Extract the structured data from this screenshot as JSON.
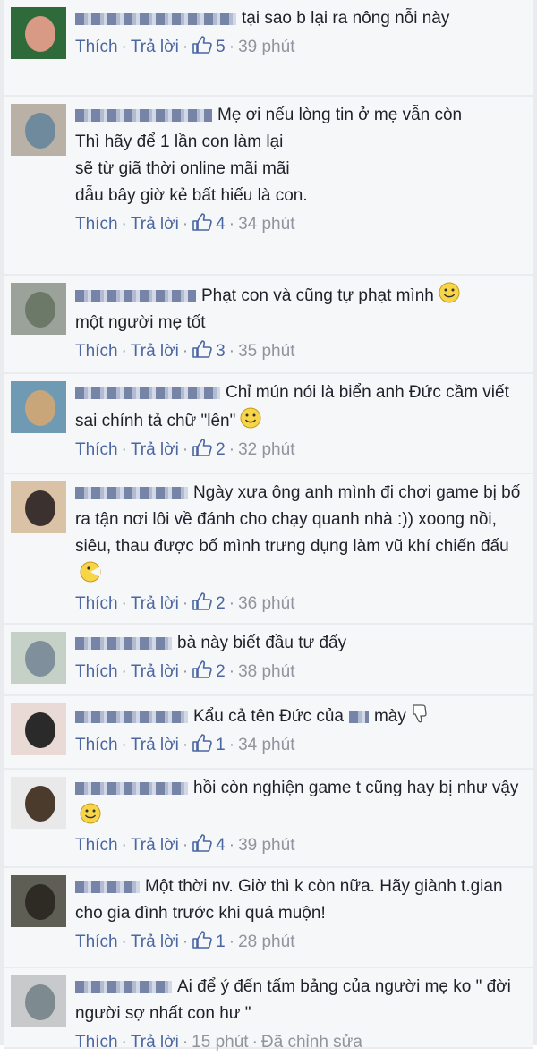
{
  "colors": {
    "link": "#4b67a1",
    "text": "#1d2129",
    "muted": "#90949c",
    "background": "#f6f7f9"
  },
  "comments": [
    {
      "text": "tại sao b lại ra nông nỗi này",
      "like": "Thích",
      "reply": "Trả lời",
      "likes": "5",
      "time": "39 phút",
      "emoji": ""
    },
    {
      "text": "Mẹ ơi nếu lòng tin ở mẹ vẫn còn\nThì hãy để 1 lần con làm lại\nsẽ từ giã thời online mãi mãi\ndẫu bây giờ kẻ bất hiếu là con.",
      "like": "Thích",
      "reply": "Trả lời",
      "likes": "4",
      "time": "34 phút",
      "emoji": ""
    },
    {
      "text": "Phạt con và cũng tự phạt mình",
      "text2": "một người mẹ tốt",
      "like": "Thích",
      "reply": "Trả lời",
      "likes": "3",
      "time": "35 phút",
      "emoji": "smile-icon"
    },
    {
      "text": "Chỉ mún nói là biển anh Đức cầm viết sai chính tả chữ \"lên\"",
      "like": "Thích",
      "reply": "Trả lời",
      "likes": "2",
      "time": "32 phút",
      "emoji": "grin-icon"
    },
    {
      "text": "Ngày xưa ông anh mình đi chơi game bị bố ra tận nơi lôi về đánh cho chạy quanh nhà :)) xoong nồi, siêu, thau được bố mình trưng dụng làm vũ khí chiến đấu",
      "like": "Thích",
      "reply": "Trả lời",
      "likes": "2",
      "time": "36 phút",
      "emoji": "pacman-icon"
    },
    {
      "text": "bà này biết đầu tư đấy",
      "like": "Thích",
      "reply": "Trả lời",
      "likes": "2",
      "time": "38 phút",
      "emoji": ""
    },
    {
      "text": "Kẩu cả tên Đức của",
      "text_tail": "mày",
      "like": "Thích",
      "reply": "Trả lời",
      "likes": "1",
      "time": "34 phút",
      "emoji": "thumbs-down-icon"
    },
    {
      "text": "hồi còn nghiện game t cũng hay bị như vậy",
      "like": "Thích",
      "reply": "Trả lời",
      "likes": "4",
      "time": "39 phút",
      "emoji": "grin-icon"
    },
    {
      "text": "Một thời nv. Giờ thì k còn nữa. Hãy giành t.gian cho gia đình trước khi quá muộn!",
      "like": "Thích",
      "reply": "Trả lời",
      "likes": "1",
      "time": "28 phút",
      "emoji": ""
    },
    {
      "text": "Ai để ý đến tấm bảng của người mẹ ko \" đời người sợ nhất con hư \"",
      "like": "Thích",
      "reply": "Trả lời",
      "likes": "",
      "time": "15 phút",
      "edited": "Đã chỉnh sửa",
      "emoji": ""
    }
  ]
}
